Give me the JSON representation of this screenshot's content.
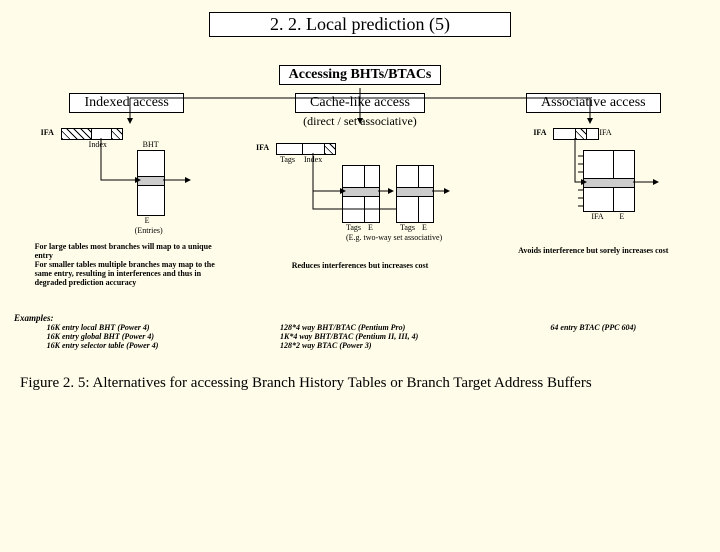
{
  "title": "2. 2. Local prediction (5)",
  "subtitle": "Accessing BHTs/BTACs",
  "indexed": {
    "heading": "Indexed access",
    "sub": "",
    "labels": {
      "ifa": "IFA",
      "index": "Index",
      "bht": "BHT",
      "e": "E",
      "entries": "(Entries)"
    },
    "desc": "For large tables most branches will map to a unique entry\nFor smaller tables multiple branches may map to the same entry, resulting in interferences and thus in degraded prediction accuracy"
  },
  "cache": {
    "heading": "Cache-like access",
    "sub": "(direct / set associative)",
    "labels": {
      "ifa": "IFA",
      "tags": "Tags",
      "index": "Index",
      "e": "E",
      "caption": "(E.g. two-way set associative)"
    },
    "tradeoff": "Reduces interferences but increases cost"
  },
  "assoc": {
    "heading": "Associative access",
    "sub": "",
    "labels": {
      "ifa": "IFA",
      "e": "E"
    },
    "tradeoff": "Avoids interference but sorely increases cost"
  },
  "examples_label": "Examples:",
  "examples": {
    "indexed": "16K entry local BHT (Power 4)\n16K entry global BHT (Power 4)\n16K entry selector table (Power 4)",
    "cache": "128*4 way BHT/BTAC (Pentium Pro)\n1K*4 way BHT/BTAC (Pentium II, III, 4)\n128*2 way BTAC (Power 3)",
    "assoc": "64 entry BTAC (PPC 604)"
  },
  "caption": "Figure 2. 5: Alternatives for accessing Branch History Tables or Branch Target Address Buffers"
}
